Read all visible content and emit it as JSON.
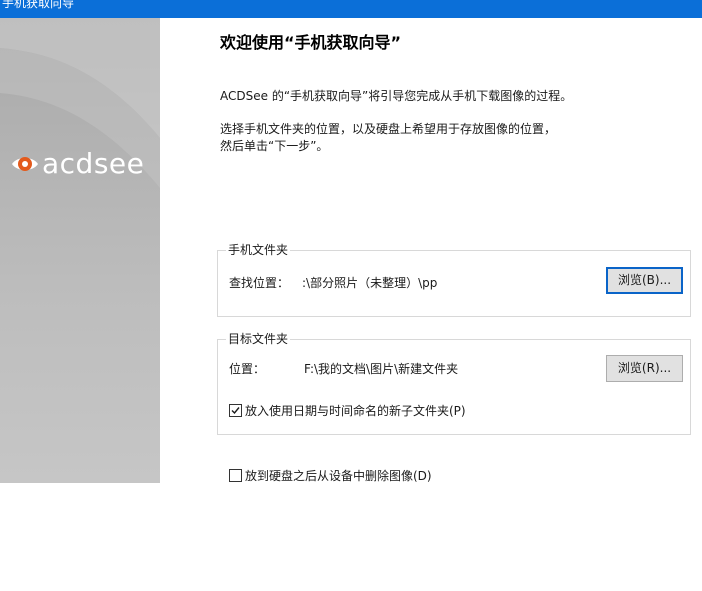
{
  "window": {
    "title": "手机获取向导"
  },
  "sidebar": {
    "logo_text": "acdsee",
    "logo_icon": "acdsee-eye-icon"
  },
  "content": {
    "heading": "欢迎使用“手机获取向导”",
    "intro": "ACDSee 的“手机获取向导”将引导您完成从手机下载图像的过程。",
    "instruction_line1": "选择手机文件夹的位置，以及硬盘上希望用于存放图像的位置，",
    "instruction_line2": "然后单击“下一步”。"
  },
  "phone_folder": {
    "legend": "手机文件夹",
    "location_label": "查找位置：",
    "location_value": ":\\部分照片（未整理）\\pp",
    "browse_label": "浏览(B)..."
  },
  "target_folder": {
    "legend": "目标文件夹",
    "location_label": "位置：",
    "location_value": "F:\\我的文档\\图片\\新建文件夹",
    "browse_label": "浏览(R)...",
    "date_subfolder_label": "放入使用日期与时间命名的新子文件夹(P)",
    "date_subfolder_checked": true
  },
  "delete_after": {
    "label": "放到硬盘之后从设备中删除图像(D)",
    "checked": false
  }
}
